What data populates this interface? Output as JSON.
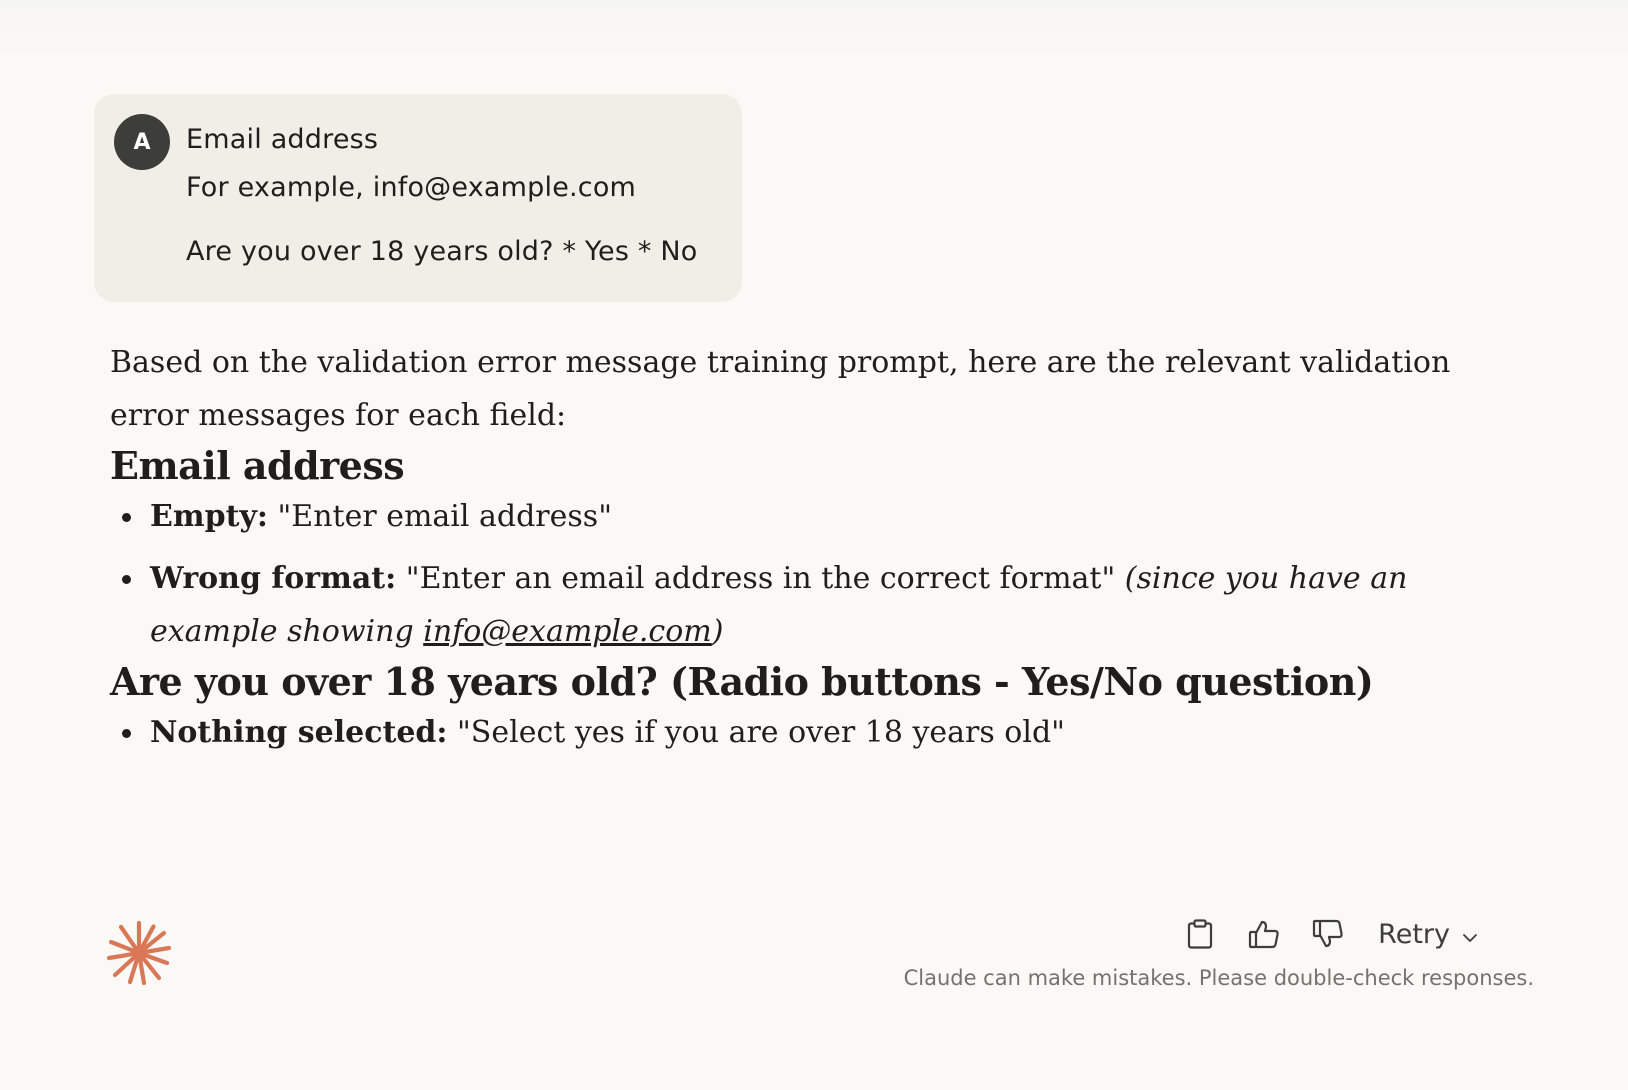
{
  "user_message": {
    "avatar_initial": "A",
    "lines": [
      "Email address",
      "For example, info@example.com",
      "Are you over 18 years old? * Yes * No"
    ]
  },
  "response": {
    "intro": "Based on the validation error message training prompt, here are the relevant validation error messages for each field:",
    "sections": [
      {
        "heading": "Email address",
        "items": [
          {
            "label": "Empty:",
            "text": " \"Enter email address\""
          },
          {
            "label": "Wrong format:",
            "text": " \"Enter an email address in the correct format\" ",
            "note_prefix": "(since you have an example showing ",
            "note_link": "info@example.com",
            "note_suffix": ")"
          }
        ]
      },
      {
        "heading": "Are you over 18 years old? (Radio buttons - Yes/No question)",
        "items": [
          {
            "label": "Nothing selected:",
            "text": " \"Select yes if you are over 18 years old\""
          }
        ]
      }
    ]
  },
  "footer": {
    "logo_icon": "claude-asterisk-icon",
    "actions": {
      "copy_icon": "clipboard-icon",
      "thumbs_up_icon": "thumbs-up-icon",
      "thumbs_down_icon": "thumbs-down-icon",
      "retry_label": "Retry"
    },
    "disclaimer": "Claude can make mistakes. Please double-check responses."
  },
  "colors": {
    "background": "#faf9f5",
    "user_bubble": "#f0eee7",
    "avatar": "#3d3d3a",
    "accent": "#d97757",
    "text": "#1f1e1d",
    "muted_text": "#73726c"
  }
}
